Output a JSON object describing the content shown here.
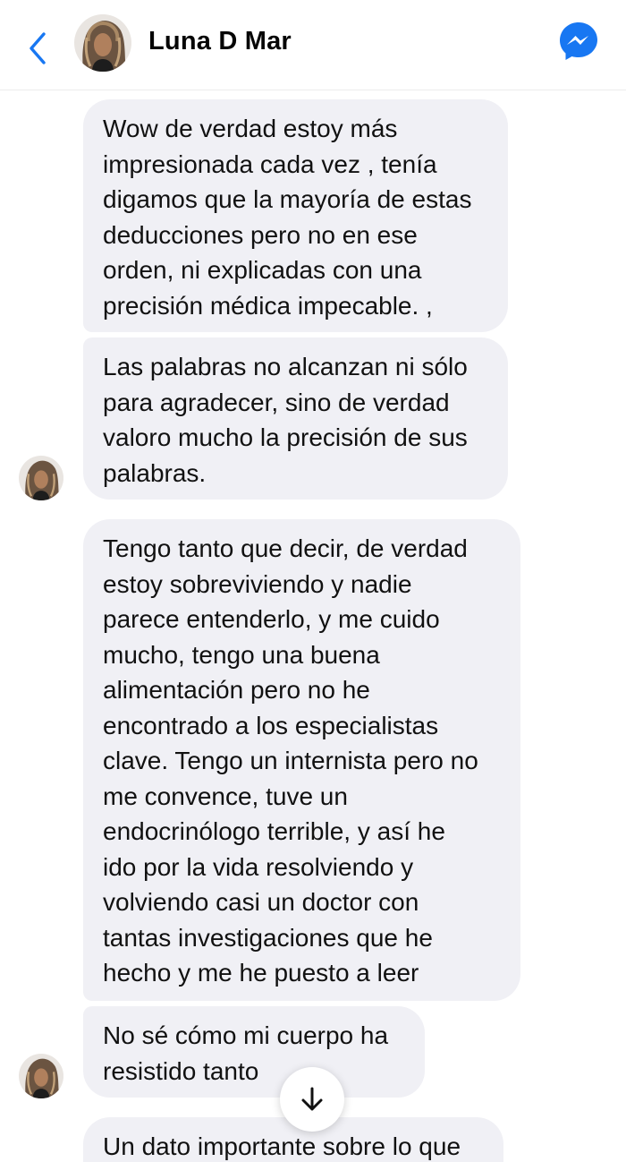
{
  "header": {
    "contact_name": "Luna D Mar",
    "back_icon": "chevron-left-icon",
    "messenger_icon": "messenger-icon",
    "accent_color": "#1877f2"
  },
  "messages": [
    {
      "sender": "Luna D Mar",
      "text": "Wow de verdad estoy más\nimpresionada cada vez , tenía\ndigamos que la mayoría de estas\ndeducciones pero no en ese\norden, ni explicadas con una\nprecisión médica impecable. ,"
    },
    {
      "sender": "Luna D Mar",
      "text": "Las palabras no alcanzan ni sólo\npara agradecer, sino de verdad\nvaloro mucho la precisión de sus\npalabras."
    },
    {
      "sender": "Luna D Mar",
      "text": "Tengo tanto que decir, de verdad\nestoy sobreviviendo y nadie\nparece entenderlo, y me cuido\nmucho, tengo una buena\nalimentación pero no he\nencontrado a los especialistas\nclave. Tengo un internista pero no\nme convence, tuve un\nendocrinólogo terrible, y así he\nido por la vida resolviendo y\nvolviendo casi un doctor con\ntantas investigaciones que he\nhecho y me he puesto a leer"
    },
    {
      "sender": "Luna D Mar",
      "text": "No sé cómo mi cuerpo ha\nresistido tanto"
    },
    {
      "sender": "Luna D Mar",
      "text": "Un dato importante sobre lo que"
    }
  ],
  "scroll_button": {
    "icon": "arrow-down-icon"
  },
  "bubble_color": "#f0f0f5"
}
